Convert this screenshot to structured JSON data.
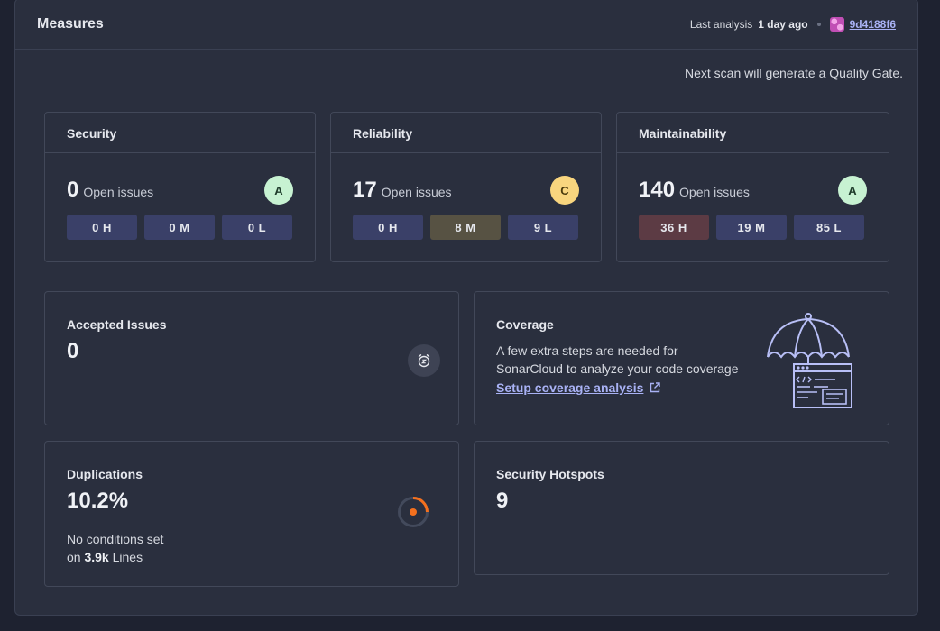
{
  "header": {
    "title": "Measures",
    "last_analysis_label": "Last analysis",
    "last_analysis_value": "1 day ago",
    "commit": "9d4188f6"
  },
  "quality_gate_note": "Next scan will generate a Quality Gate.",
  "open_issues_label": "Open issues",
  "cards": {
    "security": {
      "title": "Security",
      "count": "0",
      "grade": "A",
      "high": "0 H",
      "medium": "0 M",
      "low": "0 L"
    },
    "reliability": {
      "title": "Reliability",
      "count": "17",
      "grade": "C",
      "high": "0 H",
      "medium": "8 M",
      "low": "9 L"
    },
    "maintainability": {
      "title": "Maintainability",
      "count": "140",
      "grade": "A",
      "high": "36 H",
      "medium": "19 M",
      "low": "85 L"
    }
  },
  "accepted_issues": {
    "title": "Accepted Issues",
    "value": "0"
  },
  "coverage": {
    "title": "Coverage",
    "line1": "A few extra steps are needed for",
    "line2": "SonarCloud to analyze your code coverage",
    "link": "Setup coverage analysis"
  },
  "duplications": {
    "title": "Duplications",
    "value": "10.2%",
    "note_line1": "No conditions set",
    "note_prefix": "on",
    "note_lines_count": "3.9k",
    "note_suffix": "Lines"
  },
  "security_hotspots": {
    "title": "Security Hotspots",
    "value": "9"
  },
  "colors": {
    "grade_a": "#c7f2d2",
    "grade_c": "#f8d57e",
    "sev_default": "#3a4068",
    "sev_high": "#5c3b44",
    "sev_medium": "#575243",
    "accent_orange": "#f4701e",
    "link": "#a9b2f5"
  }
}
